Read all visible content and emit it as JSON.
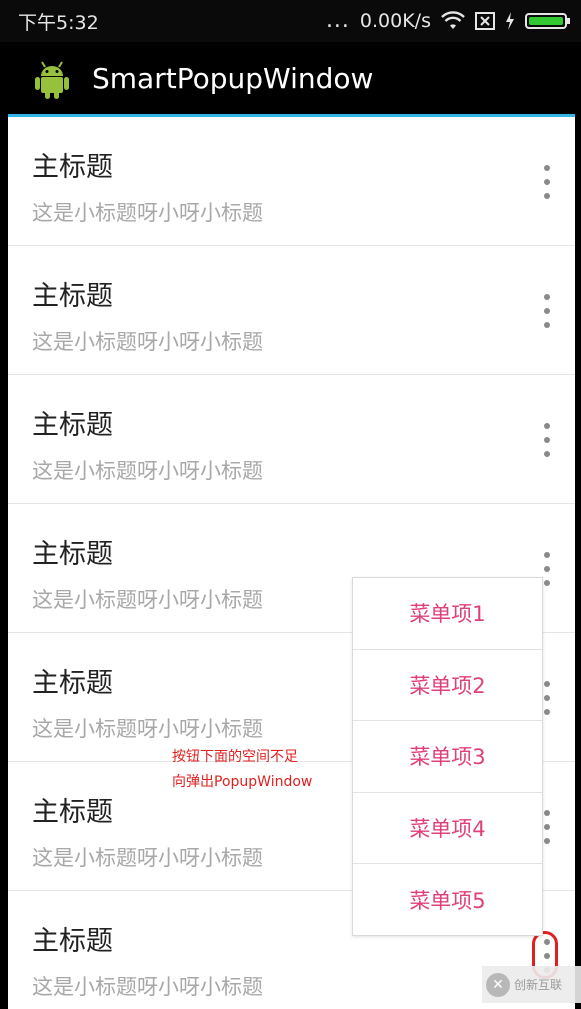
{
  "status_bar": {
    "time": "下午5:32",
    "signal_dots": "...",
    "net_speed": "0.00K/s",
    "battery_color": "#32c832"
  },
  "app_bar": {
    "title": "SmartPopupWindow",
    "accent_color": "#33b5e5"
  },
  "list": {
    "items": [
      {
        "title": "主标题",
        "subtitle": "这是小标题呀小呀小标题"
      },
      {
        "title": "主标题",
        "subtitle": "这是小标题呀小呀小标题"
      },
      {
        "title": "主标题",
        "subtitle": "这是小标题呀小呀小标题"
      },
      {
        "title": "主标题",
        "subtitle": "这是小标题呀小呀小标题"
      },
      {
        "title": "主标题",
        "subtitle": "这是小标题呀小呀小标题"
      },
      {
        "title": "主标题",
        "subtitle": "这是小标题呀小呀小标题"
      },
      {
        "title": "主标题",
        "subtitle": "这是小标题呀小呀小标题"
      }
    ]
  },
  "popup": {
    "items": [
      "菜单项1",
      "菜单项2",
      "菜单项3",
      "菜单项4",
      "菜单项5"
    ],
    "text_color": "#e0407a"
  },
  "annotation": {
    "line1": "按钮下面的空间不足",
    "line2": "向弹出PopupWindow",
    "color": "#e02020"
  },
  "watermark": {
    "text": "创新互联"
  }
}
